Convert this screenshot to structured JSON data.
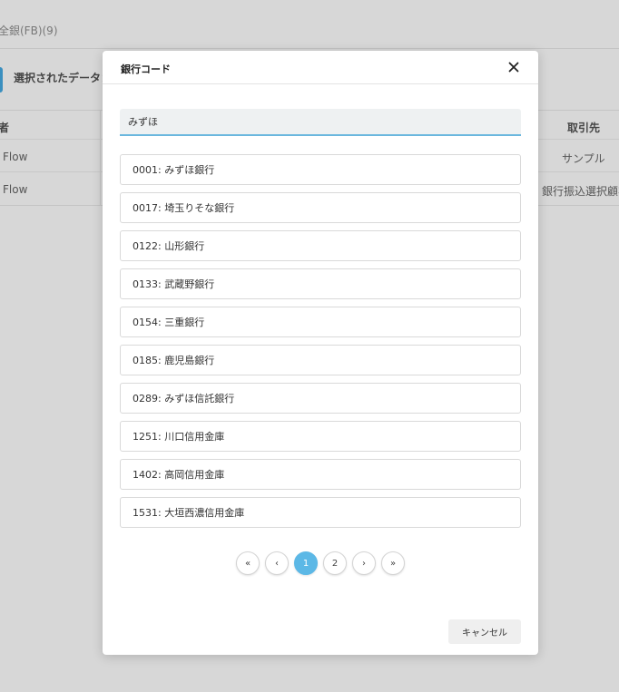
{
  "background": {
    "title": "全銀(FB)(9)",
    "selected_label": "選択されたデータ：",
    "table": {
      "header_left": "者",
      "header_right": "取引先",
      "rows": [
        {
          "left": "Flow",
          "right": "サンプル"
        },
        {
          "left": "Flow",
          "right": "銀行振込選択顧客"
        }
      ]
    }
  },
  "modal": {
    "title": "銀行コード",
    "search": {
      "value": "みずほ",
      "placeholder": ""
    },
    "banks": [
      {
        "label": "0001: みずほ銀行"
      },
      {
        "label": "0017: 埼玉りそな銀行"
      },
      {
        "label": "0122: 山形銀行"
      },
      {
        "label": "0133: 武蔵野銀行"
      },
      {
        "label": "0154: 三重銀行"
      },
      {
        "label": "0185: 鹿児島銀行"
      },
      {
        "label": "0289: みずほ信託銀行"
      },
      {
        "label": "1251: 川口信用金庫"
      },
      {
        "label": "1402: 高岡信用金庫"
      },
      {
        "label": "1531: 大垣西濃信用金庫"
      }
    ],
    "pagination": {
      "first": "«",
      "prev": "‹",
      "pages": [
        "1",
        "2"
      ],
      "current": "1",
      "next": "›",
      "last": "»"
    },
    "cancel_label": "キャンセル"
  },
  "colors": {
    "accent": "#5cb8e6",
    "input_underline": "#6bb7de"
  },
  "icons": {
    "close": "close-icon"
  }
}
